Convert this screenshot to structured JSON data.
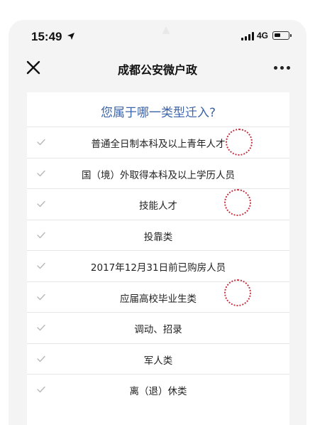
{
  "status_bar": {
    "time": "15:49",
    "network": "4G",
    "battery_level": 0.45
  },
  "nav": {
    "title": "成都公安微户政",
    "close_icon": "close-icon",
    "more_icon": "more-icon"
  },
  "card": {
    "question": "您属于哪一类型迁入?",
    "options": [
      {
        "label": "普通全日制本科及以上青年人才"
      },
      {
        "label": "国（境）外取得本科及以上学历人员"
      },
      {
        "label": "技能人才"
      },
      {
        "label": "投靠类"
      },
      {
        "label": "2017年12月31日前已购房人员"
      },
      {
        "label": "应届高校毕业生类"
      },
      {
        "label": "调动、招录"
      },
      {
        "label": "军人类"
      },
      {
        "label": "离（退）休类"
      }
    ]
  },
  "colors": {
    "question": "#3a63a8",
    "annotation": "#c23040",
    "background": "#f4f4f4"
  }
}
